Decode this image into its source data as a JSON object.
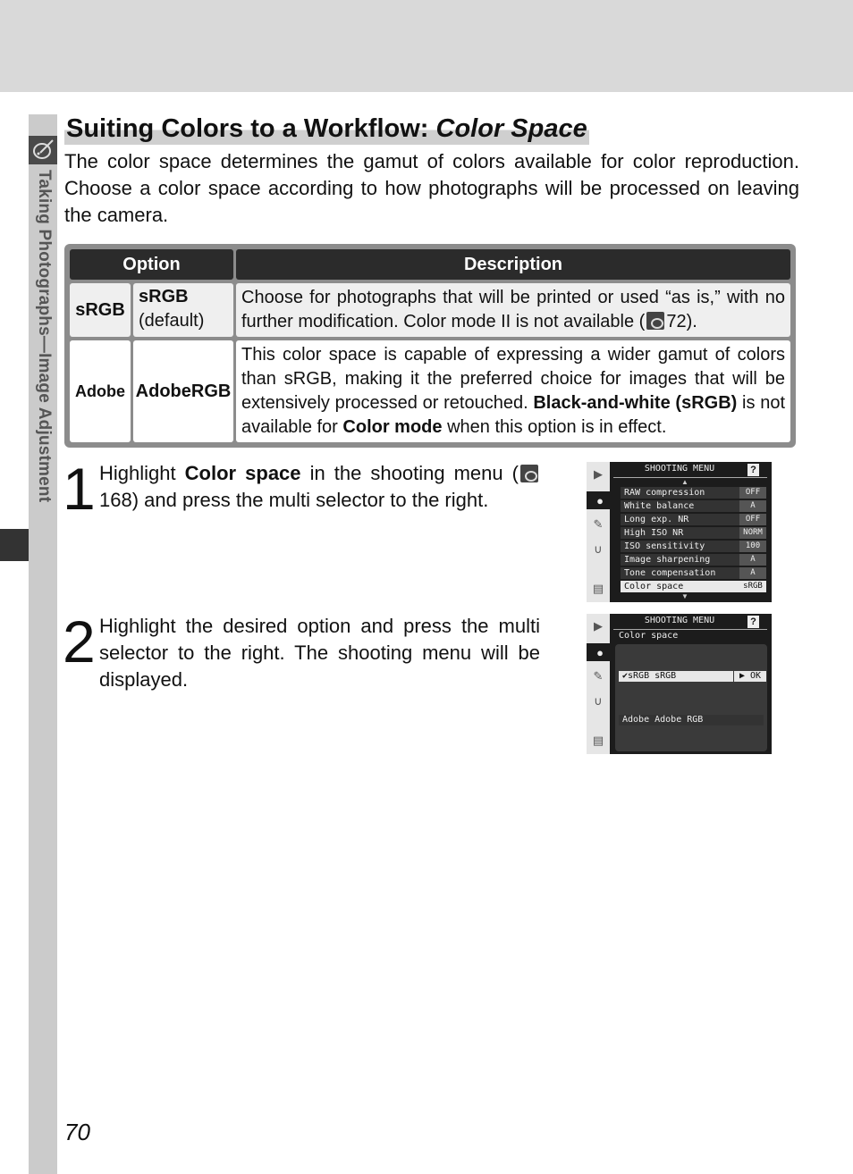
{
  "section": {
    "title_plain": "Suiting Colors to a Workflow: ",
    "title_italic": "Color Space",
    "intro": "The color space determines the gamut of colors available for color reproduction.  Choose a color space according to how photographs will be processed on leaving the camera."
  },
  "side_tab": {
    "icon": "palette-brush-icon",
    "label": "Taking Photographs—Image Adjustment"
  },
  "table": {
    "headers": [
      "Option",
      "Description"
    ],
    "rows": [
      {
        "icon_label": "sRGB",
        "option": "sRGB",
        "option_note": "(default)",
        "description_parts": [
          "Choose for photographs that will be printed or used “as is,” with no further modification.  Color mode II is not available (",
          "72)."
        ]
      },
      {
        "icon_label": "Adobe",
        "option": "AdobeRGB",
        "option_note": "",
        "description_parts": [
          "This color space is capable of expressing a wider gamut of colors than sRGB, making it the preferred choice for images that will be extensively processed or retouched.  ",
          "Black-and-white (sRGB)",
          " is not available for ",
          "Color mode",
          " when this option is in effect."
        ]
      }
    ]
  },
  "steps": [
    {
      "number": "1",
      "parts": [
        "Highlight ",
        "Color space",
        " in the shooting menu (",
        "168) and press the multi selector to the right."
      ]
    },
    {
      "number": "2",
      "text": "Highlight the desired option and press the multi selector to the right.  The shooting menu will be displayed."
    }
  ],
  "screen1": {
    "title": "SHOOTING MENU",
    "help": "?",
    "tabs": [
      "playback-icon",
      "camera-icon",
      "pencil-icon",
      "wrench-icon",
      "recent-settings-icon"
    ],
    "items": [
      {
        "label": "RAW compression",
        "value": "OFF"
      },
      {
        "label": "White balance",
        "value": "A"
      },
      {
        "label": "Long exp. NR",
        "value": "OFF"
      },
      {
        "label": "High ISO NR",
        "value": "NORM"
      },
      {
        "label": "ISO sensitivity",
        "value": "100"
      },
      {
        "label": "Image sharpening",
        "value": "A"
      },
      {
        "label": "Tone compensation",
        "value": "A"
      },
      {
        "label": "Color space",
        "value": "sRGB",
        "highlighted": true
      }
    ]
  },
  "screen2": {
    "title": "SHOOTING MENU",
    "help": "?",
    "subtitle": "Color space",
    "options": [
      {
        "label": "✔sRGB  sRGB",
        "highlighted": true,
        "action": "▶ OK"
      },
      {
        "label": "Adobe  Adobe RGB",
        "highlighted": false
      }
    ]
  },
  "page_number": "70"
}
